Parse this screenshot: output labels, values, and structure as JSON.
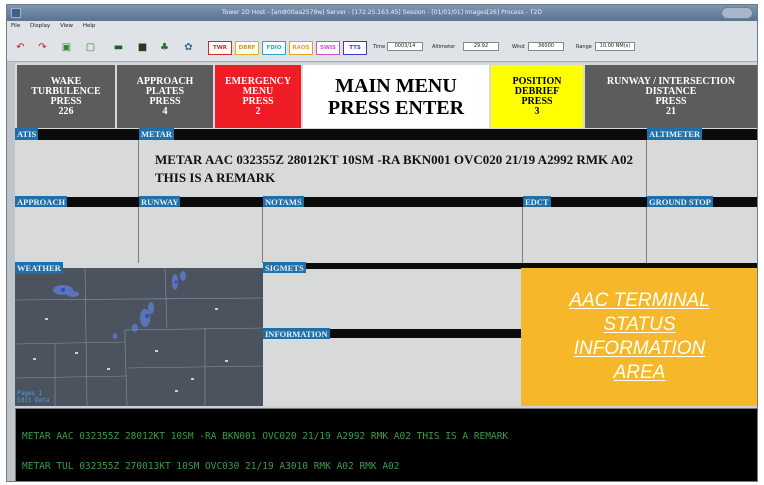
{
  "window": {
    "title": "Tower 2D Host - [am800aa2579w] Server - [172.25.163.45] Session - [01/01/01] Images[26] Process - T2D",
    "menu": [
      "File",
      "Display",
      "View",
      "Help"
    ]
  },
  "toolbar": {
    "icons": [
      "undo-icon",
      "redo-icon",
      "map-icon",
      "window-icon",
      "monitor-icon",
      "display-icon",
      "tree-icon",
      "gear-icon"
    ],
    "buttons": [
      {
        "label": "TWR",
        "color": "#d62a2a"
      },
      {
        "label": "DBRF",
        "color": "#d9b400"
      },
      {
        "label": "FDIO",
        "color": "#28a7c8"
      },
      {
        "label": "RAOS",
        "color": "#e6a02a"
      },
      {
        "label": "SWIS",
        "color": "#cc4fd0"
      },
      {
        "label": "TTS",
        "color": "#3a3ad1"
      }
    ],
    "time_label": "Time",
    "time_value": "0003/14",
    "altimeter_label": "Altimeter",
    "altimeter_value": "29.92",
    "wind_label": "Wind",
    "wind_value": "36000",
    "range_label": "Range",
    "range_value": "10.00 NM(s)"
  },
  "header": {
    "wake": {
      "lines": [
        "WAKE",
        "TURBULENCE",
        "PRESS",
        "226"
      ],
      "bg": "#5c5c5c",
      "fg": "#ffffff"
    },
    "approach_plates": {
      "lines": [
        "APPROACH",
        "PLATES",
        "PRESS",
        "4"
      ],
      "bg": "#5c5c5c",
      "fg": "#ffffff"
    },
    "emergency": {
      "lines": [
        "EMERGENCY",
        "MENU",
        "PRESS",
        "2"
      ],
      "bg": "#ee1c24",
      "fg": "#ffffff"
    },
    "main_menu": {
      "lines": [
        "MAIN MENU",
        "PRESS ENTER"
      ],
      "bg": "#ffffff",
      "fg": "#000000"
    },
    "position_debrief": {
      "lines": [
        "POSITION",
        "DEBRIEF",
        "PRESS",
        "3"
      ],
      "bg": "#ffff00",
      "fg": "#000000"
    },
    "runway_intersection": {
      "lines": [
        "RUNWAY / INTERSECTION",
        "DISTANCE",
        "PRESS",
        "21"
      ],
      "bg": "#5c5c5c",
      "fg": "#ffffff"
    }
  },
  "sections": {
    "atis": "ATIS",
    "metar": "METAR",
    "altimeter": "ALTIMETER",
    "approach": "APPROACH",
    "runway": "RUNWAY",
    "notams": "NOTAMS",
    "edct": "EDCT",
    "ground_stop": "GROUND STOP",
    "weather": "WEATHER",
    "sigmets": "SIGMETS",
    "information": "INFORMATION"
  },
  "metar_text": "METAR AAC 032355Z 28012KT 10SM -RA BKN001 OVC020 21/19 A2992 RMK A02 THIS IS A REMARK",
  "weather_map": {
    "status_lines": [
      "Pages 1",
      "Edit Data"
    ]
  },
  "terminal_area": {
    "lines": [
      "AAC TERMINAL",
      "STATUS",
      "INFORMATION",
      "AREA"
    ]
  },
  "console": {
    "lines": [
      "METAR AAC 032355Z 28012KT 10SM -RA BKN001 OVC020 21/19 A2992 RMK A02 THIS IS A REMARK",
      "METAR TUL 032355Z 270013KT 10SM OVC030 21/19 A3010 RMK A02 RMK A02"
    ]
  }
}
